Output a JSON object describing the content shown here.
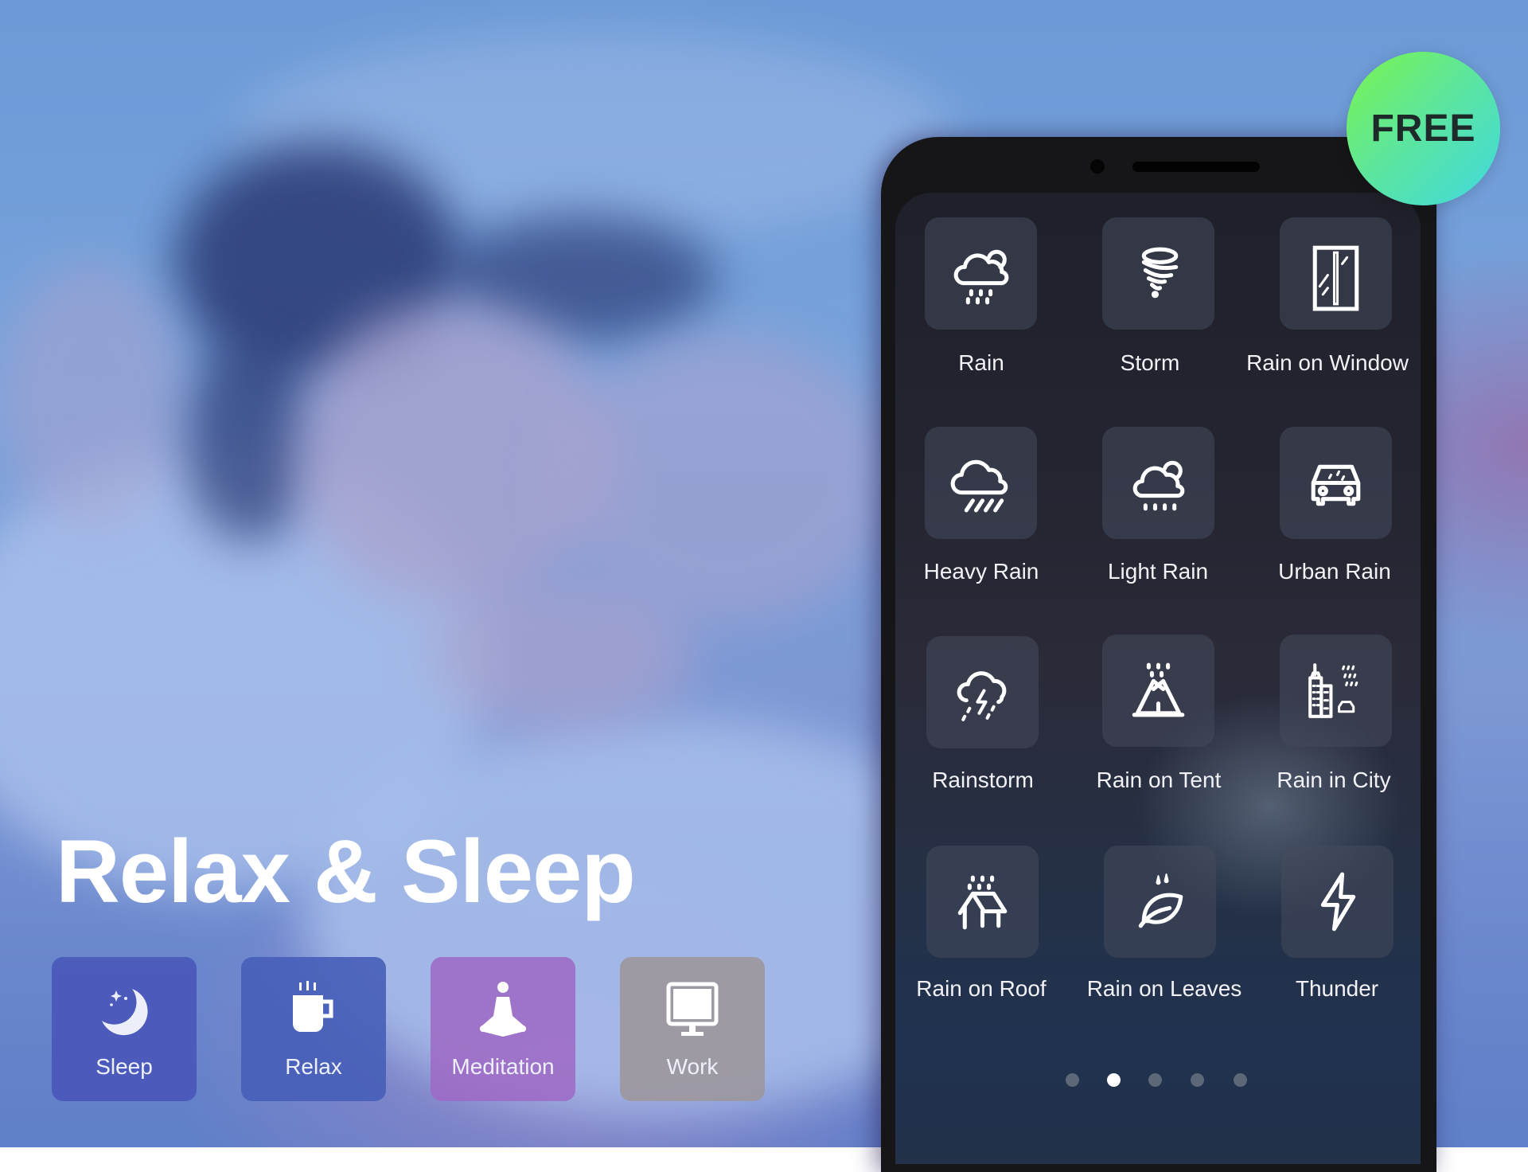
{
  "hero": {
    "title": "Relax & Sleep"
  },
  "badge": {
    "label": "FREE",
    "gradient_start": "#7cf54a",
    "gradient_end": "#3fd9e0"
  },
  "categories": [
    {
      "label": "Sleep",
      "icon": "moon-stars-icon",
      "color": "#4e5fbc"
    },
    {
      "label": "Relax",
      "icon": "coffee-cup-icon",
      "color": "#4c64b9"
    },
    {
      "label": "Meditation",
      "icon": "meditation-icon",
      "color": "#9a6cc0"
    },
    {
      "label": "Work",
      "icon": "monitor-icon",
      "color": "#9a9499"
    }
  ],
  "sounds": [
    {
      "label": "Rain",
      "icon": "cloud-rain-sun-icon"
    },
    {
      "label": "Storm",
      "icon": "tornado-icon"
    },
    {
      "label": "Rain on Window",
      "icon": "window-icon"
    },
    {
      "label": "Heavy Rain",
      "icon": "cloud-heavy-rain-icon"
    },
    {
      "label": "Light Rain",
      "icon": "cloud-light-rain-icon"
    },
    {
      "label": "Urban Rain",
      "icon": "car-icon"
    },
    {
      "label": "Rainstorm",
      "icon": "cloud-lightning-rain-icon"
    },
    {
      "label": "Rain on Tent",
      "icon": "tent-rain-icon"
    },
    {
      "label": "Rain in City",
      "icon": "city-rain-icon"
    },
    {
      "label": "Rain on Roof",
      "icon": "roof-rain-icon"
    },
    {
      "label": "Rain on Leaves",
      "icon": "leaf-drops-icon"
    },
    {
      "label": "Thunder",
      "icon": "lightning-bolt-icon"
    }
  ],
  "pagination": {
    "pages": 5,
    "current": 2
  }
}
